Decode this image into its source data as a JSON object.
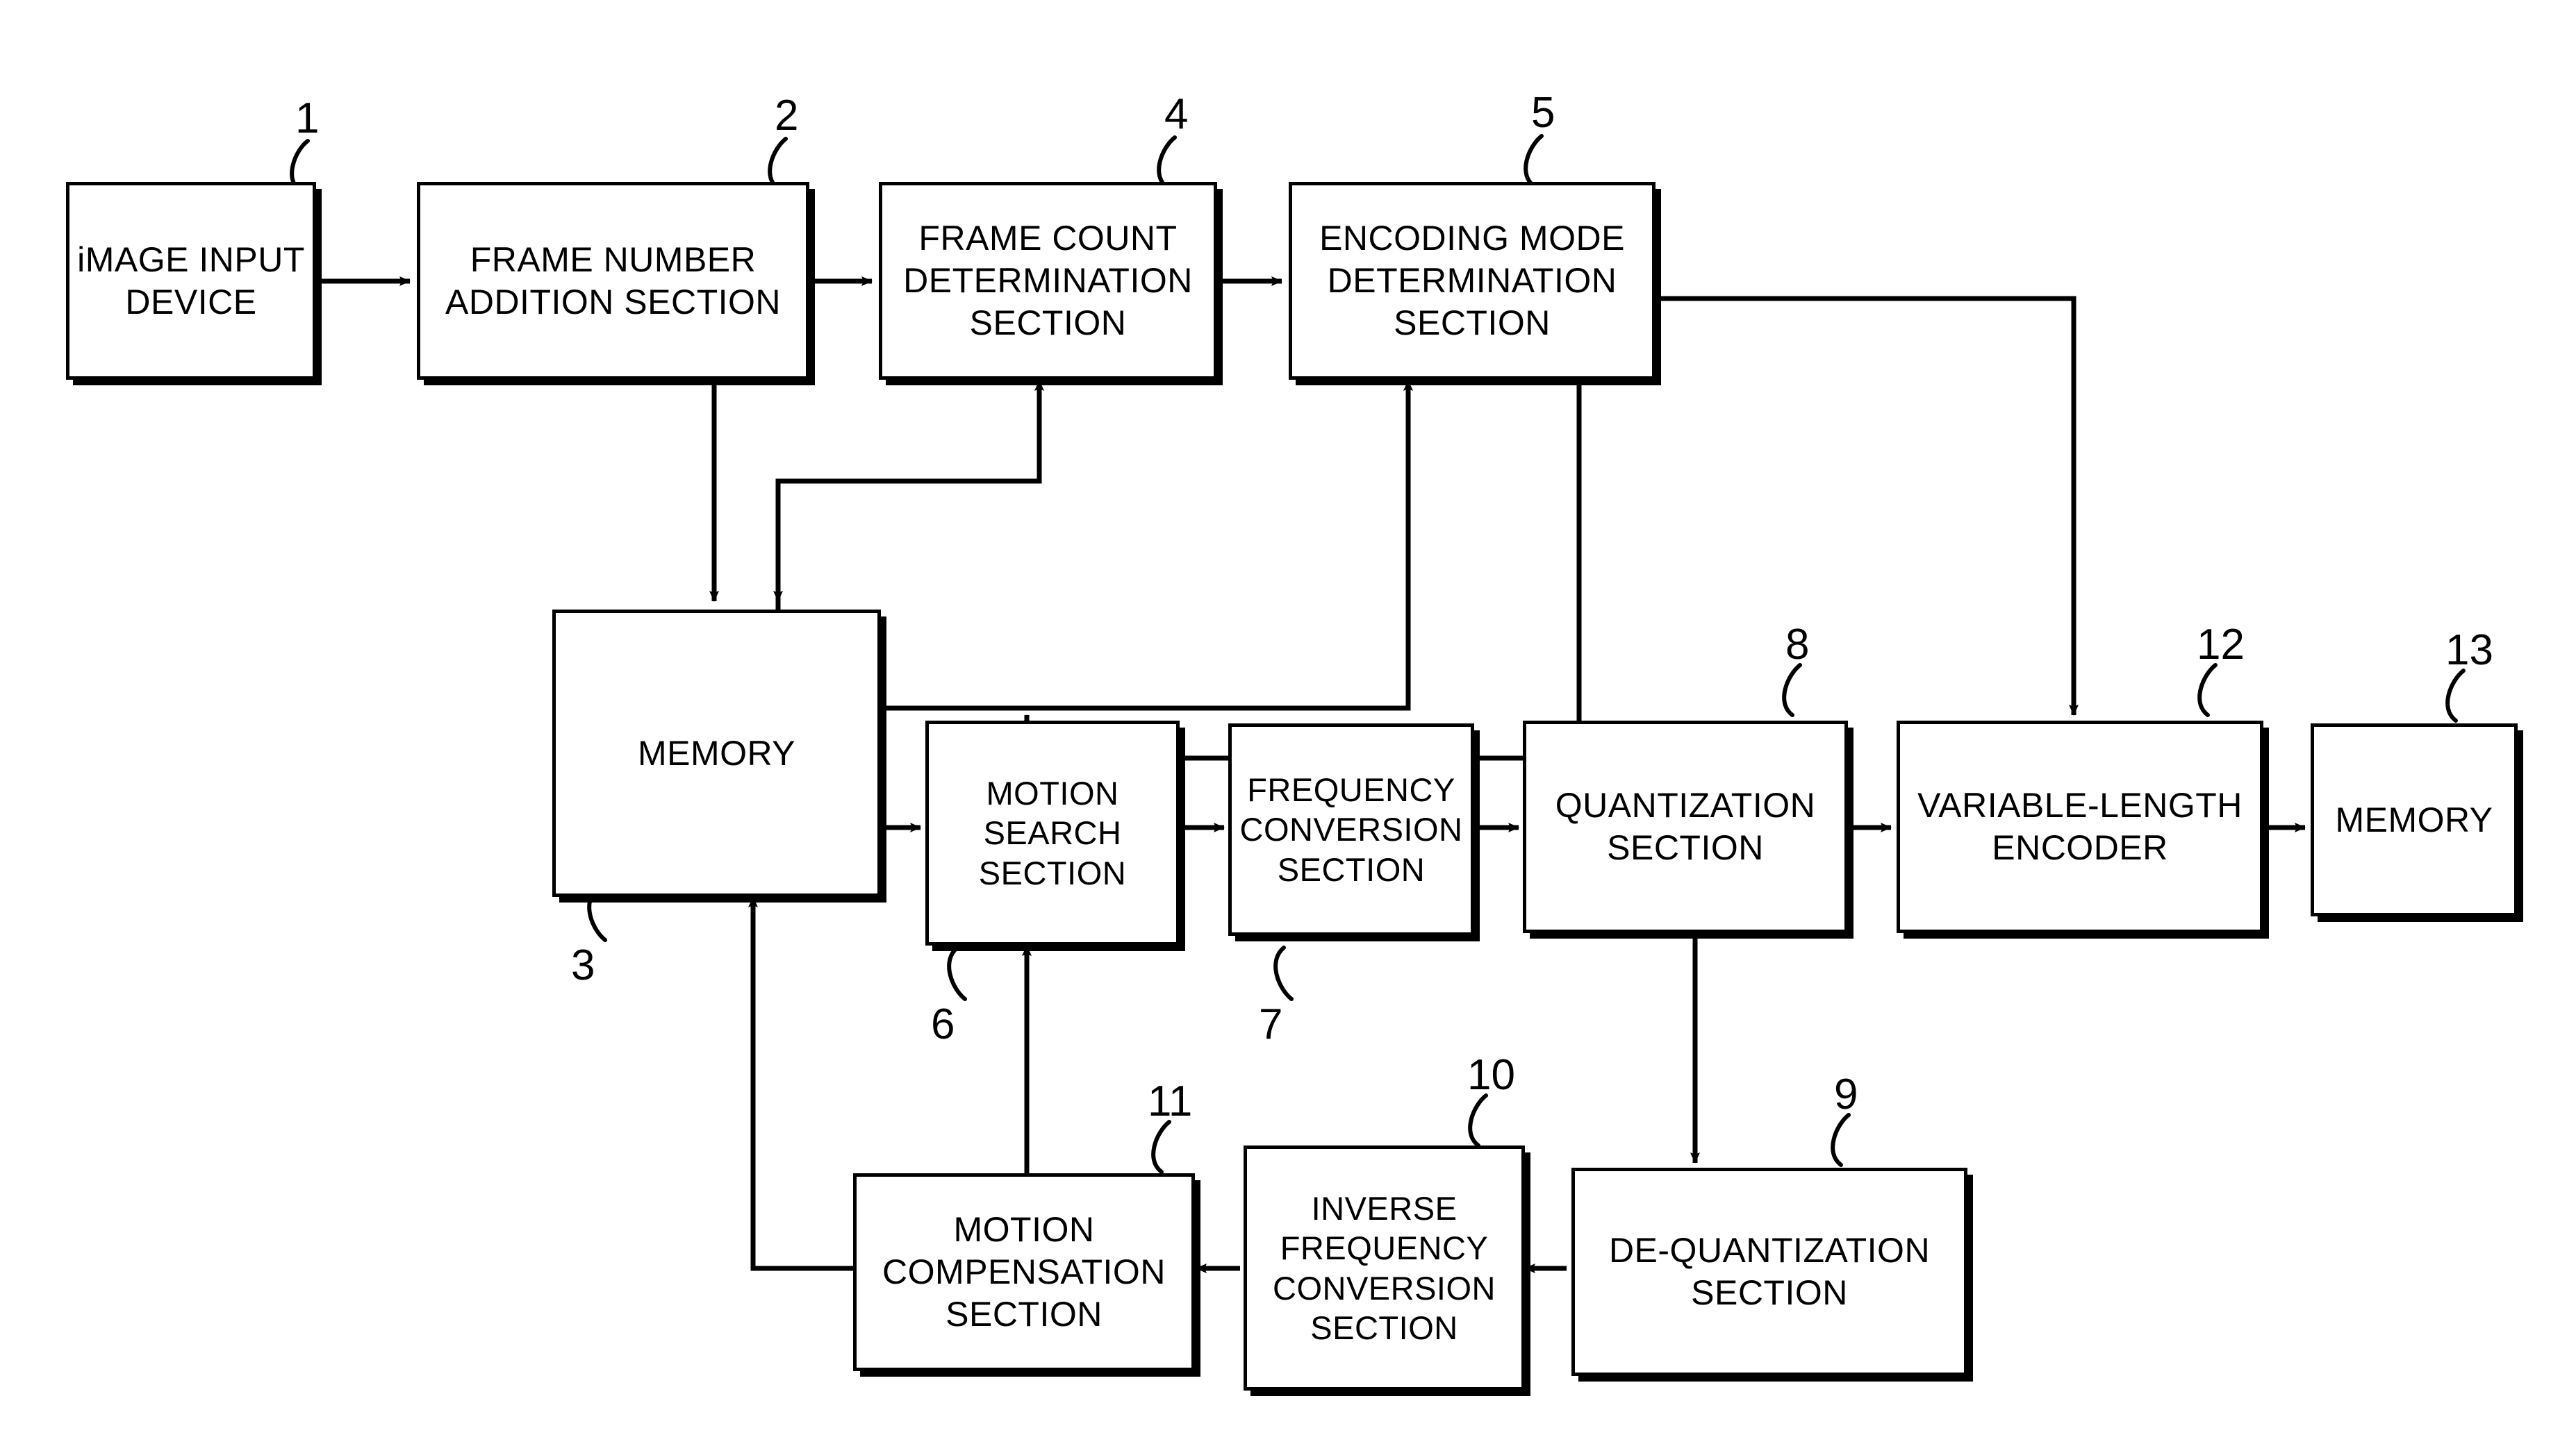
{
  "figure": {
    "type": "patent-block-diagram",
    "title": "Video encoding apparatus block diagram",
    "background": "#ffffff",
    "line_color": "#000000"
  },
  "blocks": [
    {
      "id": "image_input_device",
      "ref": "1",
      "lines": [
        "iMAGE INPUT",
        "DEVICE"
      ]
    },
    {
      "id": "frame_number_addition",
      "ref": "2",
      "lines": [
        "FRAME NUMBER",
        "ADDITION SECTION"
      ]
    },
    {
      "id": "frame_count_determination",
      "ref": "4",
      "lines": [
        "FRAME COUNT",
        "DETERMINATION",
        "SECTION"
      ]
    },
    {
      "id": "encoding_mode_determination",
      "ref": "5",
      "lines": [
        "ENCODING MODE",
        "DETERMINATION",
        "SECTION"
      ]
    },
    {
      "id": "memory_main",
      "ref": "3",
      "lines": [
        "MEMORY"
      ]
    },
    {
      "id": "motion_search",
      "ref": "6",
      "lines": [
        "MOTION",
        "SEARCH",
        "SECTION"
      ]
    },
    {
      "id": "frequency_conversion",
      "ref": "7",
      "lines": [
        "FREQUENCY",
        "CONVERSION",
        "SECTION"
      ]
    },
    {
      "id": "quantization",
      "ref": "8",
      "lines": [
        "QUANTIZATION",
        "SECTION"
      ]
    },
    {
      "id": "variable_length_encoder",
      "ref": "12",
      "lines": [
        "VARIABLE-LENGTH",
        "ENCODER"
      ]
    },
    {
      "id": "memory_output",
      "ref": "13",
      "lines": [
        "MEMORY"
      ]
    },
    {
      "id": "de_quantization",
      "ref": "9",
      "lines": [
        "DE-QUANTIZATION",
        "SECTION"
      ]
    },
    {
      "id": "inverse_frequency_conversion",
      "ref": "10",
      "lines": [
        "INVERSE",
        "FREQUENCY",
        "CONVERSION",
        "SECTION"
      ]
    },
    {
      "id": "motion_compensation",
      "ref": "11",
      "lines": [
        "MOTION",
        "COMPENSATION",
        "SECTION"
      ]
    }
  ],
  "reference_numerals": [
    "1",
    "2",
    "4",
    "5",
    "3",
    "6",
    "7",
    "8",
    "12",
    "13",
    "9",
    "10",
    "11"
  ]
}
